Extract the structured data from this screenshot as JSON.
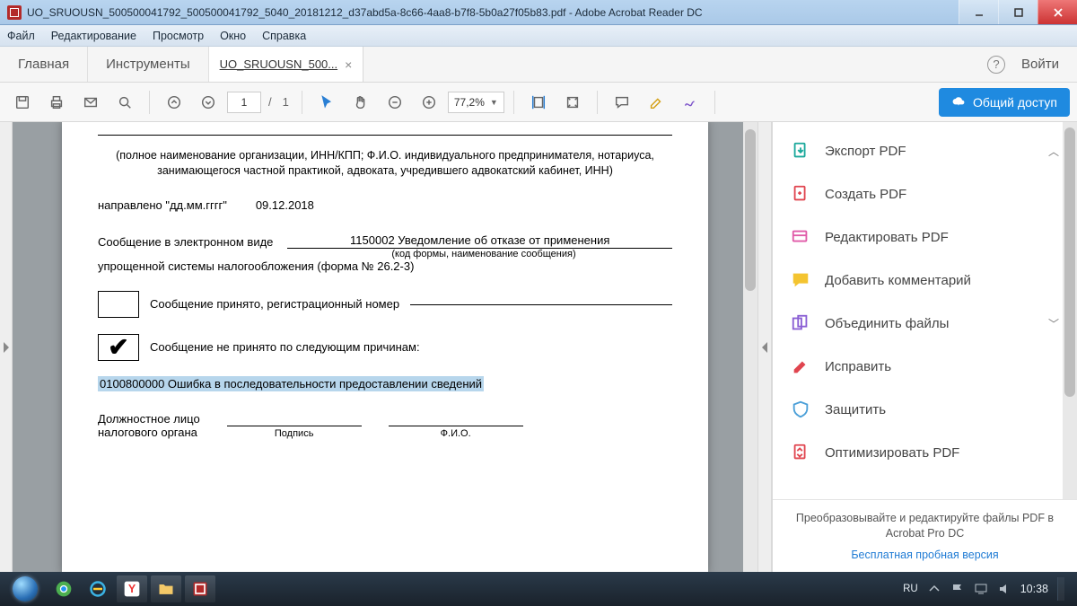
{
  "window": {
    "title": "UO_SRUOUSN_500500041792_500500041792_5040_20181212_d37abd5a-8c66-4aa8-b7f8-5b0a27f05b83.pdf - Adobe Acrobat Reader DC"
  },
  "menu": {
    "file": "Файл",
    "edit": "Редактирование",
    "view": "Просмотр",
    "window": "Окно",
    "help": "Справка"
  },
  "apptabs": {
    "home": "Главная",
    "tools": "Инструменты",
    "doc_short": "UO_SRUOUSN_500...",
    "signin": "Войти"
  },
  "toolbar": {
    "page_current": "1",
    "page_total": "1",
    "zoom": "77,2%",
    "share": "Общий доступ"
  },
  "document": {
    "org_line": "(полное наименование организации, ИНН/КПП; Ф.И.О. индивидуального предпринимателя, нотариуса, занимающегося частной практикой, адвоката, учредившего адвокатский кабинет, ИНН)",
    "sent_label": "направлено \"дд.мм.гггг\"",
    "sent_date": "09.12.2018",
    "msg_label": "Сообщение в электронном виде",
    "msg_code": "1150002 Уведомление об отказе от применения",
    "msg_caption": "(код формы, наименование сообщения)",
    "msg_line2": "упрощенной системы налогообложения (форма № 26.2-3)",
    "accepted_label": "Сообщение принято, регистрационный номер",
    "rejected_label": "Сообщение не принято по следующим причинам:",
    "error_text": "0100800000 Ошибка в последовательности предоставлении сведений",
    "official_line1": "Должностное лицо",
    "official_line2": "налогового органа",
    "signature": "Подпись",
    "fio": "Ф.И.О."
  },
  "rpanel": {
    "items": [
      {
        "label": "Экспорт PDF",
        "expandable": true,
        "open": true
      },
      {
        "label": "Создать PDF",
        "expandable": false
      },
      {
        "label": "Редактировать PDF",
        "expandable": false
      },
      {
        "label": "Добавить комментарий",
        "expandable": false
      },
      {
        "label": "Объединить файлы",
        "expandable": true,
        "open": false
      },
      {
        "label": "Исправить",
        "expandable": false
      },
      {
        "label": "Защитить",
        "expandable": false
      },
      {
        "label": "Оптимизировать PDF",
        "expandable": false
      }
    ],
    "footer1": "Преобразовывайте и редактируйте файлы PDF в Acrobat Pro DC",
    "trial": "Бесплатная пробная версия"
  },
  "taskbar": {
    "lang": "RU",
    "clock": "10:38"
  }
}
